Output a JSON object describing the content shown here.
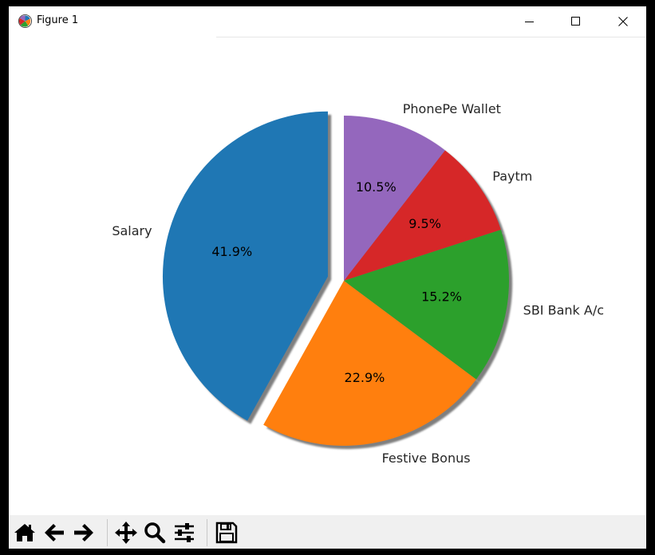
{
  "window": {
    "title": "Figure 1",
    "icons": {
      "app": "matplotlib-logo-icon",
      "minimize": "minimize-icon",
      "maximize": "maximize-icon",
      "close": "close-icon"
    }
  },
  "toolbar": {
    "buttons": [
      {
        "name": "home-button",
        "icon": "home-icon"
      },
      {
        "name": "back-button",
        "icon": "arrow-left-icon"
      },
      {
        "name": "forward-button",
        "icon": "arrow-right-icon"
      },
      {
        "name": "pan-button",
        "icon": "move-icon"
      },
      {
        "name": "zoom-button",
        "icon": "magnifier-icon"
      },
      {
        "name": "configure-subplots-button",
        "icon": "sliders-icon"
      },
      {
        "name": "save-button",
        "icon": "floppy-disk-icon"
      }
    ]
  },
  "chart_data": {
    "type": "pie",
    "title": "",
    "slices": [
      {
        "label": "Salary",
        "pct": 41.9,
        "pct_label": "41.9%",
        "color": "#1f77b4",
        "explode": true
      },
      {
        "label": "Festive Bonus",
        "pct": 22.9,
        "pct_label": "22.9%",
        "color": "#ff7f0e",
        "explode": false
      },
      {
        "label": "SBI Bank A/c",
        "pct": 15.2,
        "pct_label": "15.2%",
        "color": "#2ca02c",
        "explode": false
      },
      {
        "label": "Paytm",
        "pct": 9.5,
        "pct_label": "9.5%",
        "color": "#d62728",
        "explode": false
      },
      {
        "label": "PhonePe Wallet",
        "pct": 10.5,
        "pct_label": "10.5%",
        "color": "#9467bd",
        "explode": false
      }
    ],
    "start_angle": 90,
    "counterclockwise": true,
    "shadow": true,
    "legend": false
  }
}
